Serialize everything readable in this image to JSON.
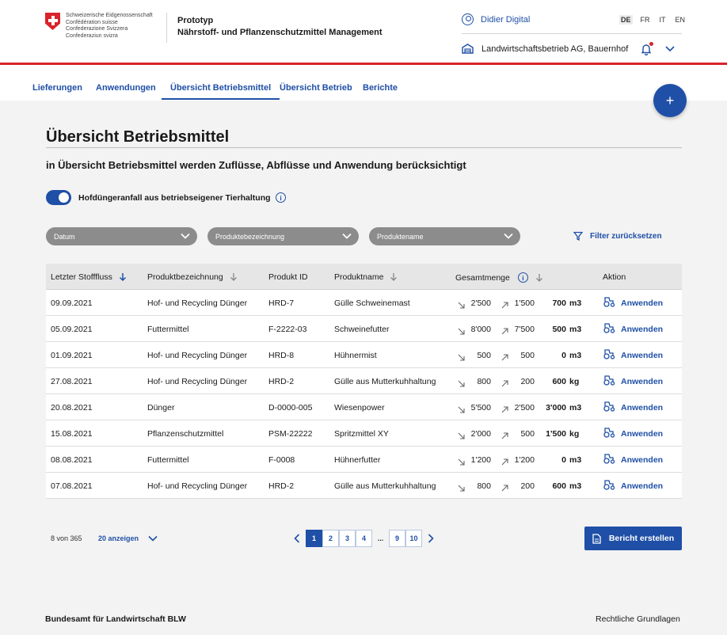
{
  "header": {
    "confederation": [
      "Schweizerische Eidgenossenschaft",
      "Confédération suisse",
      "Confederazione Svizzera",
      "Confederaziun svizra"
    ],
    "app_label": "Prototyp",
    "app_name": "Nährstoff- und Pflanzenschutzmittel Management",
    "user": "Didier Digital",
    "languages": [
      "DE",
      "FR",
      "IT",
      "EN"
    ],
    "active_language": "DE",
    "farm": "Landwirtschaftsbetrieb AG, Bauernhof"
  },
  "nav": {
    "items": [
      "Lieferungen",
      "Anwendungen",
      "Übersicht Betriebsmittel",
      "Übersicht Betrieb",
      "Berichte"
    ],
    "active": "Übersicht Betriebsmittel",
    "fab_label": "+"
  },
  "page": {
    "title": "Übersicht Betriebsmittel",
    "subtitle": "in Übersicht Betriebsmittel werden Zuflüsse, Abflüsse und Anwendung berücksichtigt",
    "toggle_label": "Hofdüngeranfall aus betriebseigener Tierhaltung",
    "toggle_on": true,
    "info_glyph": "i"
  },
  "filters": {
    "items": [
      "Datum",
      "Produktebezeichnung",
      "Produktename"
    ],
    "reset_label": "Filter zurücksetzen"
  },
  "table": {
    "headers": {
      "date": "Letzter Stofffluss",
      "category": "Produktbezeichnung",
      "product_id": "Produkt ID",
      "product_name": "Produktname",
      "total": "Gesamtmenge",
      "action": "Aktion"
    },
    "rows": [
      {
        "date": "09.09.2021",
        "category": "Hof- und Recycling Dünger",
        "id": "HRD-7",
        "name": "Gülle Schweinemast",
        "in": "2'500",
        "out": "1'500",
        "total": "700",
        "unit": "m3",
        "action": "Anwenden"
      },
      {
        "date": "05.09.2021",
        "category": "Futtermittel",
        "id": "F-2222-03",
        "name": "Schweinefutter",
        "in": "8'000",
        "out": "7'500",
        "total": "500",
        "unit": "m3",
        "action": "Anwenden"
      },
      {
        "date": "01.09.2021",
        "category": "Hof- und Recycling Dünger",
        "id": "HRD-8",
        "name": "Hühnermist",
        "in": "500",
        "out": "500",
        "total": "0",
        "unit": "m3",
        "action": "Anwenden"
      },
      {
        "date": "27.08.2021",
        "category": "Hof- und Recycling Dünger",
        "id": "HRD-2",
        "name": "Gülle aus Mutterkuhhaltung",
        "in": "800",
        "out": "200",
        "total": "600",
        "unit": "kg",
        "action": "Anwenden"
      },
      {
        "date": "20.08.2021",
        "category": "Dünger",
        "id": "D-0000-005",
        "name": "Wiesenpower",
        "in": "5'500",
        "out": "2'500",
        "total": "3'000",
        "unit": "m3",
        "action": "Anwenden"
      },
      {
        "date": "15.08.2021",
        "category": "Pflanzenschutzmittel",
        "id": "PSM-22222",
        "name": "Spritzmittel XY",
        "in": "2'000",
        "out": "500",
        "total": "1'500",
        "unit": "kg",
        "action": "Anwenden"
      },
      {
        "date": "08.08.2021",
        "category": "Futtermittel",
        "id": "F-0008",
        "name": "Hühnerfutter",
        "in": "1'200",
        "out": "1'200",
        "total": "0",
        "unit": "m3",
        "action": "Anwenden"
      },
      {
        "date": "07.08.2021",
        "category": "Hof- und Recycling Dünger",
        "id": "HRD-2",
        "name": "Gülle aus Mutterkuhhaltung",
        "in": "800",
        "out": "200",
        "total": "600",
        "unit": "m3",
        "action": "Anwenden"
      }
    ]
  },
  "pagination": {
    "count": "8 von 365",
    "per_page": "20 anzeigen",
    "pages": [
      "1",
      "2",
      "3",
      "4",
      "...",
      "9",
      "10"
    ],
    "active_page": "1",
    "report_button": "Bericht erstellen"
  },
  "footer": {
    "left": "Bundesamt für Landwirtschaft BLW",
    "right": "Rechtliche Grundlagen"
  },
  "colors": {
    "primary": "#1f4fa6",
    "swiss_red": "#d8232a",
    "filter_grey": "#8c8c8c",
    "background": "#f3f3f3"
  }
}
